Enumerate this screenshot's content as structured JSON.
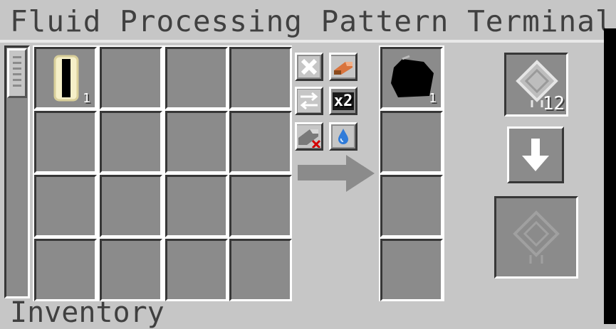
{
  "window": {
    "title": "Fluid Processing Pattern Terminal",
    "inventory_label": "Inventory"
  },
  "crafting_grid": {
    "rows": 4,
    "cols": 4,
    "items": [
      {
        "slot": 0,
        "icon": "item-icon",
        "count": "1"
      }
    ]
  },
  "buttons": {
    "clear": {
      "icon": "close-icon"
    },
    "substitute": {
      "icon": "item-substitute-icon"
    },
    "swap": {
      "icon": "swap-arrows-icon"
    },
    "multiply": {
      "icon": "multiply-icon",
      "label": "x2"
    },
    "fluid_sub": {
      "icon": "item-fluid-toggle-icon"
    },
    "fluid_first": {
      "icon": "water-drop-icon"
    }
  },
  "output": {
    "slots": 4,
    "items": [
      {
        "slot": 0,
        "icon": "fluid-item-icon",
        "count": "1"
      }
    ]
  },
  "pattern": {
    "blank_count": "12",
    "icon": "blank-pattern-icon",
    "encode_icon": "arrow-down-icon",
    "encoded_icon": "encoded-pattern-icon"
  },
  "colors": {
    "panel": "#c6c6c6",
    "slot": "#8b8b8b",
    "text": "#404040"
  }
}
